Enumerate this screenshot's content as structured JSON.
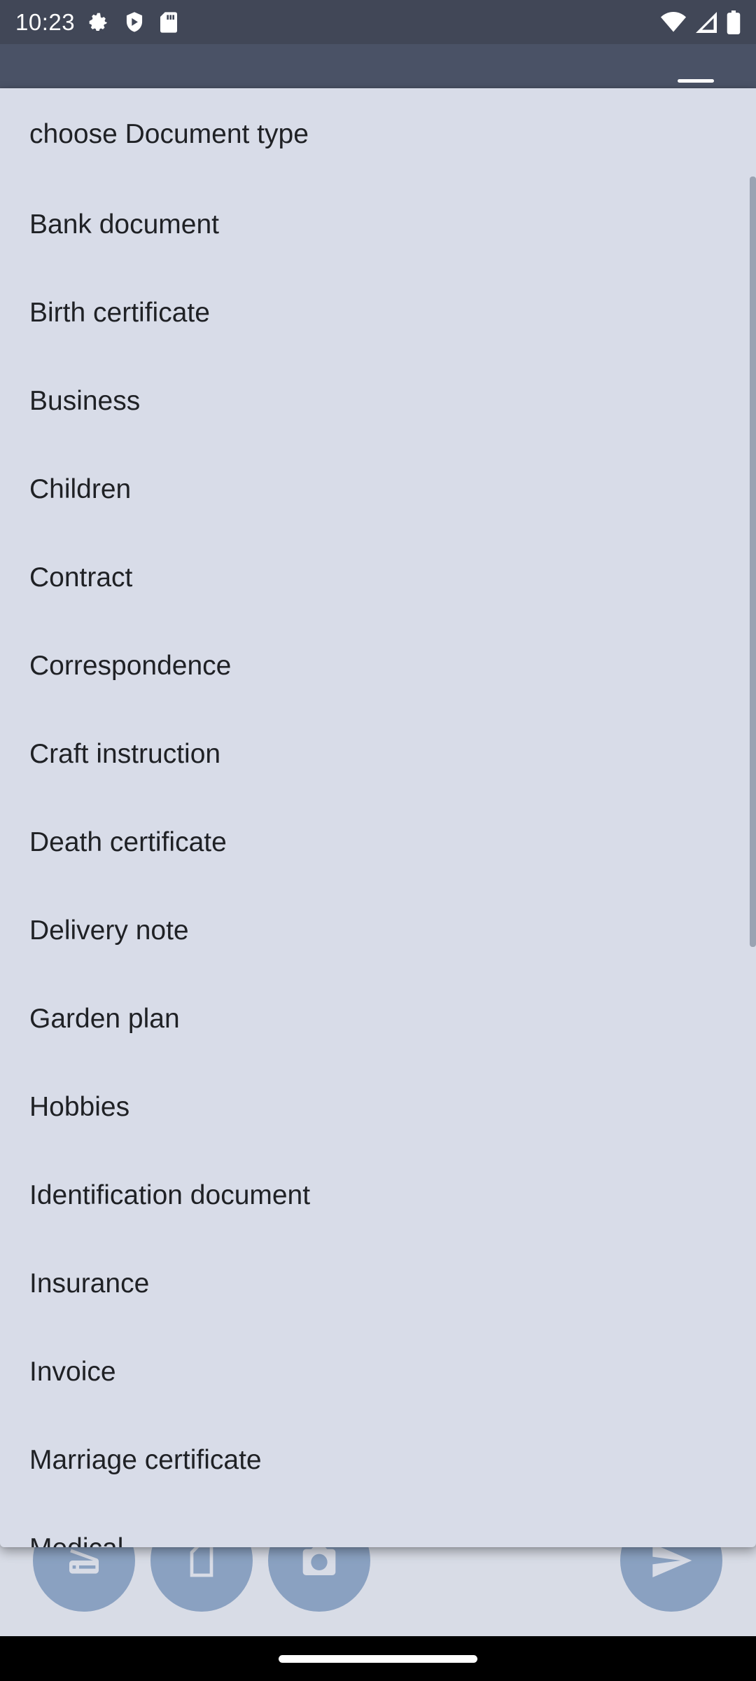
{
  "status_bar": {
    "time": "10:23",
    "left_icons": [
      "gear-icon",
      "shield-icon",
      "sd-card-icon"
    ],
    "right_icons": [
      "wifi-icon",
      "cell-signal-icon",
      "battery-icon"
    ]
  },
  "dropdown": {
    "items": [
      {
        "label": "choose Document type"
      },
      {
        "label": "Bank document"
      },
      {
        "label": "Birth certificate"
      },
      {
        "label": "Business"
      },
      {
        "label": "Children"
      },
      {
        "label": "Contract"
      },
      {
        "label": "Correspondence"
      },
      {
        "label": "Craft instruction"
      },
      {
        "label": "Death certificate"
      },
      {
        "label": "Delivery note"
      },
      {
        "label": "Garden plan"
      },
      {
        "label": "Hobbies"
      },
      {
        "label": "Identification document"
      },
      {
        "label": "Insurance"
      },
      {
        "label": "Invoice"
      },
      {
        "label": "Marriage certificate"
      },
      {
        "label": "Medical"
      }
    ]
  },
  "bottom_actions": [
    "scanner-icon",
    "document-icon",
    "camera-icon",
    "send-icon"
  ],
  "colors": {
    "status_bar_bg": "#414757",
    "dropdown_bg": "#d8dce8",
    "fab_bg": "#8aa1c1",
    "text": "#1f2125"
  }
}
